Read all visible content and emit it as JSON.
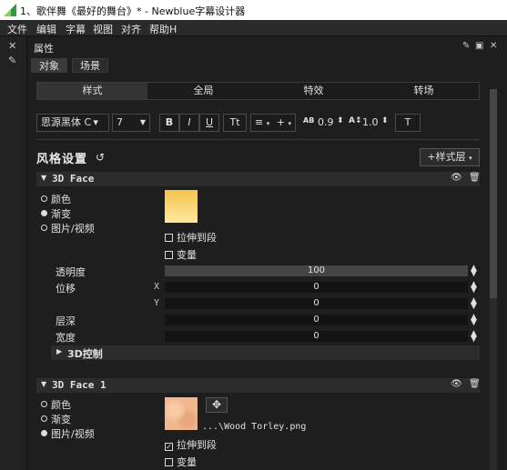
{
  "window": {
    "title": "1、歌伴舞《最好的舞台》* - Newblue字幕设计器"
  },
  "menu": [
    "文件",
    "编辑",
    "字幕",
    "视图",
    "对齐",
    "帮助H"
  ],
  "panel": {
    "title": "属性",
    "subtabs": [
      "对象",
      "场景"
    ],
    "main_tabs": [
      "样式",
      "全局",
      "特效",
      "转场"
    ]
  },
  "toolbar": {
    "font": "思源黑体 C ▾",
    "size": "7",
    "bold": "B",
    "italic": "I",
    "underline": "U",
    "text_transform": "Tt",
    "align": "≡",
    "plus": "+",
    "tracking_label": "AB",
    "tracking_value": "0.9",
    "leading_label": "A↕",
    "leading_value": "1.0",
    "text_icon": "T"
  },
  "style_heading": "风格设置",
  "add_style_label": "+样式层",
  "sections": [
    {
      "name": "3D Face",
      "fill_options": [
        "颜色",
        "渐变",
        "图片/视频"
      ],
      "fill_selected": 1,
      "stretch_label": "拉伸到段",
      "stretch_checked": false,
      "variable_label": "变量",
      "variable_checked": false,
      "props": {
        "opacity_label": "透明度",
        "opacity_value": "100",
        "position_label": "位移",
        "x_label": "X",
        "x_value": "0",
        "y_label": "Y",
        "y_value": "0",
        "depth_label": "层深",
        "depth_value": "0",
        "width_label": "宽度",
        "width_value": "0"
      },
      "sub_control": "3D控制"
    },
    {
      "name": "3D Face 1",
      "fill_options": [
        "颜色",
        "渐变",
        "图片/视频"
      ],
      "fill_selected": 2,
      "file_path": "...\\Wood Torley.png",
      "stretch_label": "拉伸到段",
      "stretch_checked": true,
      "variable_label": "变量",
      "variable_checked": false
    }
  ],
  "icons": {
    "app": "newblue-logo-icon",
    "reset": "reset-icon",
    "visibility": "eye-icon",
    "delete": "trash-icon",
    "move": "move-icon",
    "pin": "pin-icon",
    "close": "close-icon"
  },
  "colors": {
    "gradient_top": "#f3c44a",
    "gradient_bottom": "#fde9a3",
    "texture": "#f1b88f"
  }
}
